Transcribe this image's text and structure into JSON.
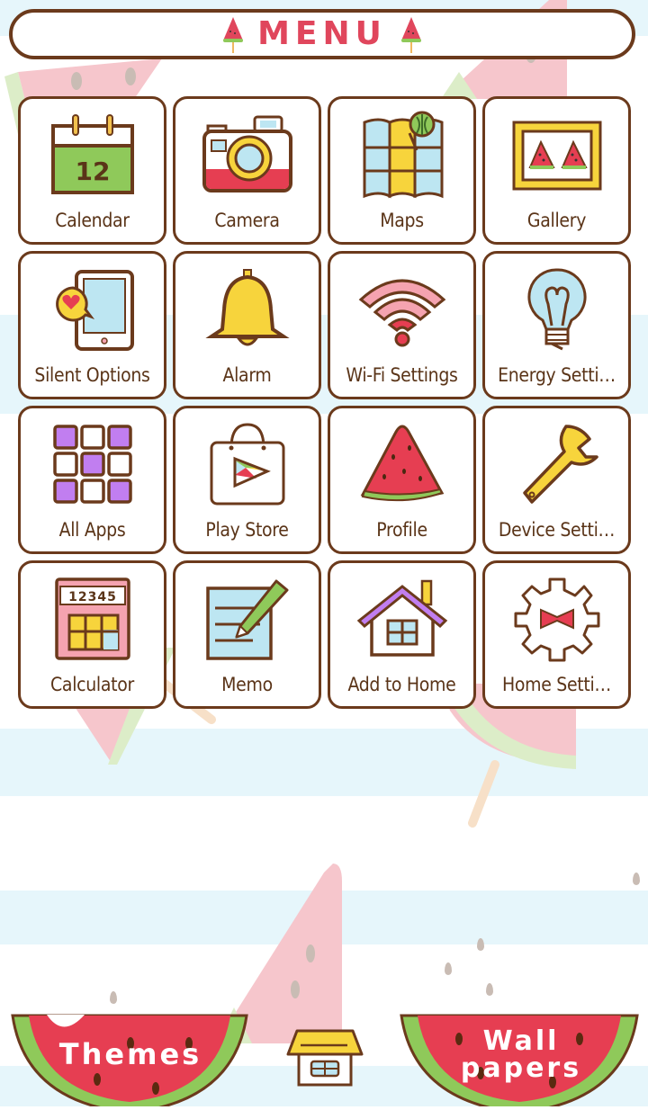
{
  "header": {
    "title": "MENU"
  },
  "colors": {
    "border": "#6b3a1c",
    "title": "#e0465c",
    "label": "#5a3418",
    "watermelon_red": "#e63e52",
    "watermelon_green": "#8fc95a",
    "yellow": "#f7d43c",
    "sky": "#bde6f2",
    "purple": "#c17ef0",
    "pink": "#f5a3b0"
  },
  "tiles": [
    {
      "label": "Calendar",
      "icon": "calendar-icon",
      "calendar_day": "12"
    },
    {
      "label": "Camera",
      "icon": "camera-icon"
    },
    {
      "label": "Maps",
      "icon": "map-icon"
    },
    {
      "label": "Gallery",
      "icon": "picture-frame-icon"
    },
    {
      "label": "Silent Options",
      "icon": "tablet-heart-icon"
    },
    {
      "label": "Alarm",
      "icon": "bell-icon"
    },
    {
      "label": "Wi-Fi Settings",
      "icon": "wifi-icon"
    },
    {
      "label": "Energy Setti…",
      "icon": "lightbulb-icon"
    },
    {
      "label": "All Apps",
      "icon": "grid-icon"
    },
    {
      "label": "Play Store",
      "icon": "shopping-bag-play-icon"
    },
    {
      "label": "Profile",
      "icon": "watermelon-slice-icon"
    },
    {
      "label": "Device Setti…",
      "icon": "wrench-icon"
    },
    {
      "label": "Calculator",
      "icon": "calculator-icon",
      "display": "12345"
    },
    {
      "label": "Memo",
      "icon": "notepad-pencil-icon"
    },
    {
      "label": "Add to Home",
      "icon": "house-icon"
    },
    {
      "label": "Home Setti…",
      "icon": "gear-bowtie-icon"
    }
  ],
  "bottom": {
    "themes_label": "Themes",
    "wallpapers_line1": "Wall",
    "wallpapers_line2": "papers",
    "home_icon": "house-icon"
  }
}
